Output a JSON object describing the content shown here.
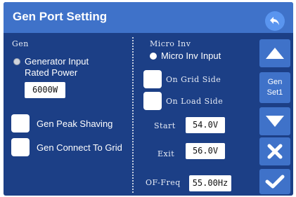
{
  "header": {
    "title": "Gen Port Setting",
    "back_icon": "back-arrow-icon"
  },
  "gen": {
    "section_label": "Gen",
    "generator_input_line1": "Generator Input",
    "generator_input_line2": "Rated Power",
    "rated_power_value": "6000W",
    "peak_shaving_label": "Gen Peak Shaving",
    "connect_to_grid_label": "Gen Connect To Grid"
  },
  "micro_inv": {
    "section_label": "Micro Inv",
    "input_label": "Micro Inv Input",
    "on_grid_side_label": "On Grid Side",
    "on_load_side_label": "On Load Side",
    "start_label": "Start",
    "start_value": "54.0V",
    "exit_label": "Exit",
    "exit_value": "56.0V",
    "of_freq_label": "OF-Freq",
    "of_freq_value": "55.00Hz"
  },
  "side_panel": {
    "set_label_line1": "Gen",
    "set_label_line2": "Set1"
  },
  "colors": {
    "background": "#1c3f86",
    "header": "#3f72c9",
    "button": "#3f72c9",
    "back_button": "#5a95ef"
  }
}
